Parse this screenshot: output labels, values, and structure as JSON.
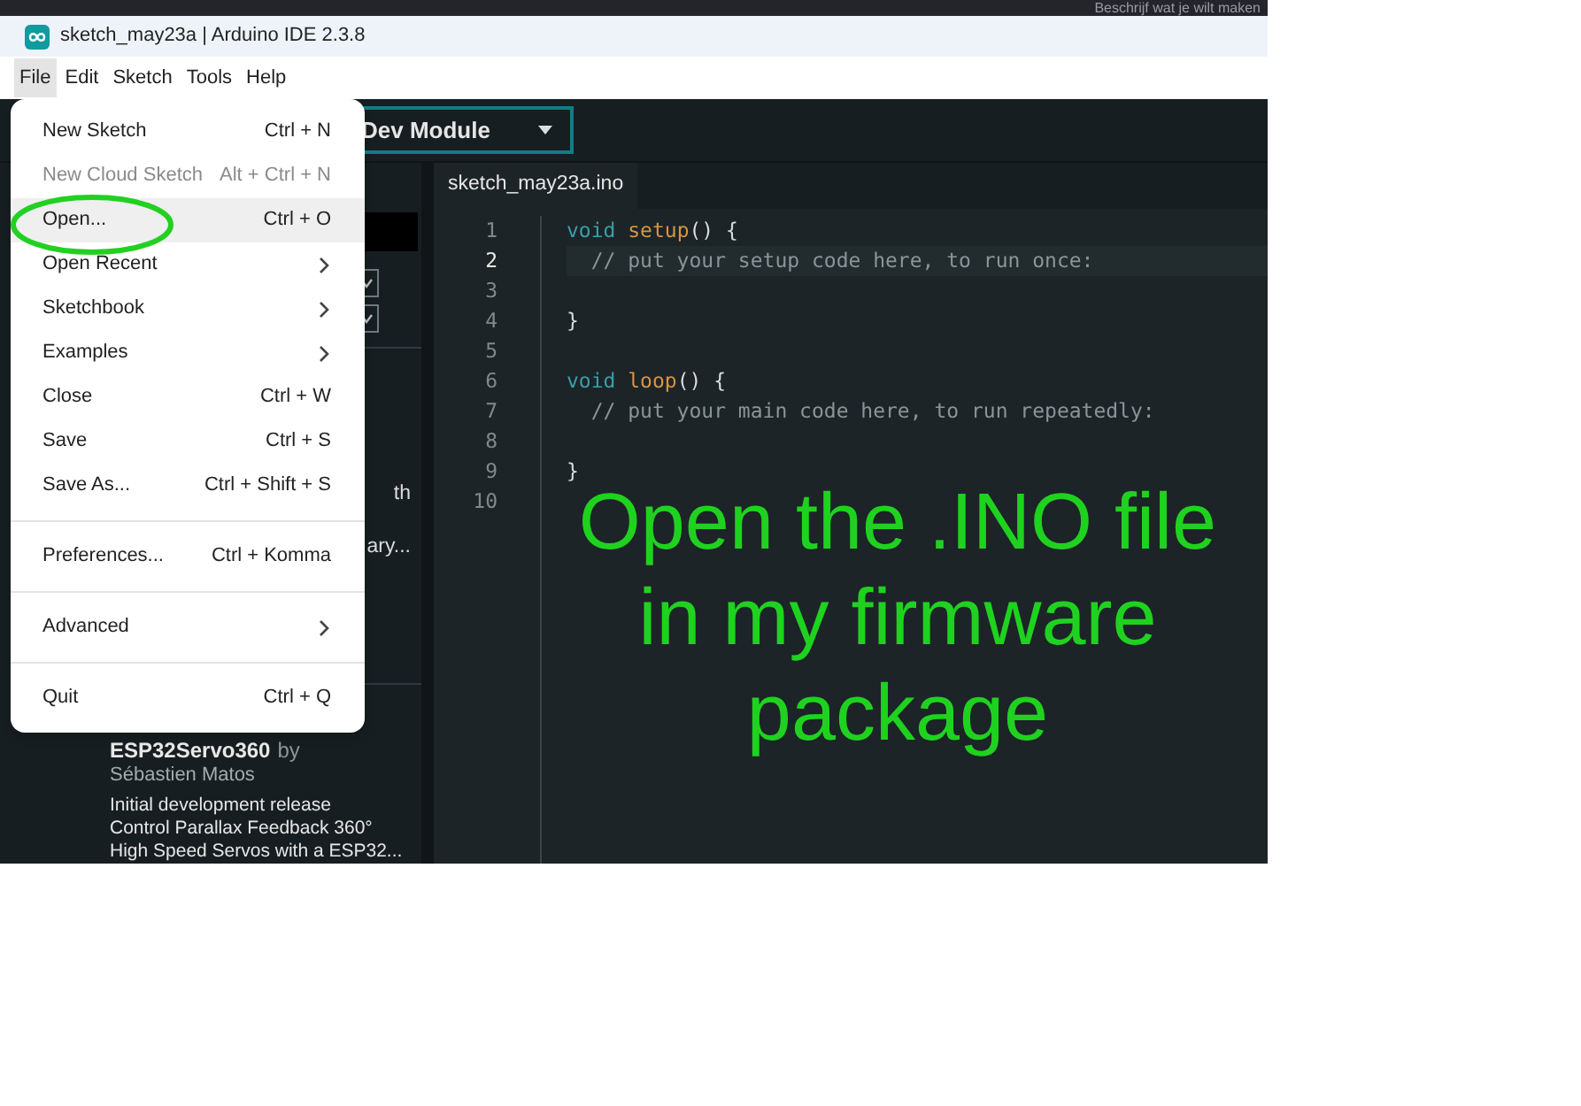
{
  "background_window": {
    "text": "Beschrijf wat je wilt maken"
  },
  "window": {
    "title": "sketch_may23a | Arduino IDE 2.3.8"
  },
  "menubar": [
    {
      "label": "File",
      "selected": true
    },
    {
      "label": "Edit",
      "selected": false
    },
    {
      "label": "Sketch",
      "selected": false
    },
    {
      "label": "Tools",
      "selected": false
    },
    {
      "label": "Help",
      "selected": false
    }
  ],
  "toolbar": {
    "board": "Dev Module"
  },
  "library_panel": {
    "fragments": [
      "th",
      "ary..."
    ],
    "entry": {
      "name": "ESP32Servo360",
      "by": "by",
      "author": "Sébastien Matos",
      "description_lines": [
        "Initial development release",
        "Control Parallax Feedback 360°",
        "High Speed Servos with a ESP32..."
      ]
    }
  },
  "editor": {
    "tab": "sketch_may23a.ino",
    "lines": [
      {
        "number": "1",
        "current": false,
        "tokens": [
          {
            "kind": "keyword",
            "text": "void"
          },
          {
            "kind": "function",
            "text": "setup"
          },
          {
            "kind": "plain",
            "text": "() {"
          }
        ]
      },
      {
        "number": "2",
        "current": true,
        "tokens": [
          {
            "kind": "comment",
            "text": "// put your setup code here, to run once:"
          }
        ]
      },
      {
        "number": "3",
        "current": false
      },
      {
        "number": "4",
        "current": false,
        "tokens": [
          {
            "kind": "plain",
            "text": "}"
          }
        ]
      },
      {
        "number": "5",
        "current": false
      },
      {
        "number": "6",
        "current": false,
        "tokens": [
          {
            "kind": "keyword",
            "text": "void"
          },
          {
            "kind": "function",
            "text": "loop"
          },
          {
            "kind": "plain",
            "text": "() {"
          }
        ]
      },
      {
        "number": "7",
        "current": false,
        "tokens": [
          {
            "kind": "comment",
            "text": "// put your main code here, to run repeatedly:"
          }
        ]
      },
      {
        "number": "8",
        "current": false
      },
      {
        "number": "9",
        "current": false,
        "tokens": [
          {
            "kind": "plain",
            "text": "}"
          }
        ]
      },
      {
        "number": "10",
        "current": false
      }
    ]
  },
  "annotation": {
    "text": "Open the .INO file in my firmware package"
  },
  "file_menu": [
    {
      "kind": "item",
      "label": "New Sketch",
      "shortcut": "Ctrl + N",
      "disabled": false,
      "selected": false
    },
    {
      "kind": "item",
      "label": "New Cloud Sketch",
      "shortcut": "Alt + Ctrl + N",
      "disabled": true,
      "selected": false
    },
    {
      "kind": "item",
      "label": "Open...",
      "shortcut": "Ctrl + O",
      "disabled": false,
      "selected": true
    },
    {
      "kind": "submenu",
      "label": "Open Recent",
      "disabled": false,
      "selected": false
    },
    {
      "kind": "submenu",
      "label": "Sketchbook",
      "disabled": false,
      "selected": false
    },
    {
      "kind": "submenu",
      "label": "Examples",
      "disabled": false,
      "selected": false
    },
    {
      "kind": "item",
      "label": "Close",
      "shortcut": "Ctrl + W",
      "disabled": false,
      "selected": false
    },
    {
      "kind": "item",
      "label": "Save",
      "shortcut": "Ctrl + S",
      "disabled": false,
      "selected": false
    },
    {
      "kind": "item",
      "label": "Save As...",
      "shortcut": "Ctrl + Shift + S",
      "disabled": false,
      "selected": false
    },
    {
      "kind": "separator"
    },
    {
      "kind": "item",
      "label": "Preferences...",
      "shortcut": "Ctrl + Komma",
      "disabled": false,
      "selected": false
    },
    {
      "kind": "separator"
    },
    {
      "kind": "submenu",
      "label": "Advanced",
      "disabled": false,
      "selected": false
    },
    {
      "kind": "separator"
    },
    {
      "kind": "item",
      "label": "Quit",
      "shortcut": "Ctrl + Q",
      "disabled": false,
      "selected": false
    }
  ]
}
